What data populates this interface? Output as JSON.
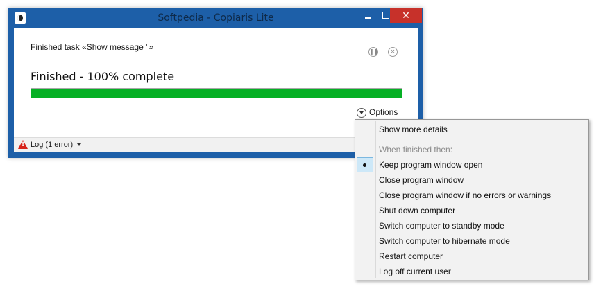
{
  "window": {
    "title": "Softpedia - Copiaris Lite",
    "close_label": "✕"
  },
  "task": {
    "label": "Finished task «Show message ''»",
    "status": "Finished - 100% complete",
    "progress_fraction": 1.0,
    "progress_color": "#06b025",
    "pause_icon": "pause-icon",
    "stop_icon": "stop-icon"
  },
  "options": {
    "label": "Options",
    "icon": "chevron-down-circle-icon"
  },
  "statusbar": {
    "log_label": "Log (1 error)",
    "log_icon": "warning-icon"
  },
  "menu": {
    "show_details": "Show more details",
    "header": "When finished then:",
    "items": [
      {
        "label": "Keep program window open",
        "checked": true
      },
      {
        "label": "Close program window",
        "checked": false
      },
      {
        "label": "Close program window if no errors or warnings",
        "checked": false
      },
      {
        "label": "Shut down computer",
        "checked": false
      },
      {
        "label": "Switch computer to standby mode",
        "checked": false
      },
      {
        "label": "Switch computer to hibernate mode",
        "checked": false
      },
      {
        "label": "Restart computer",
        "checked": false
      },
      {
        "label": "Log off current user",
        "checked": false
      }
    ]
  },
  "colors": {
    "accent": "#1d5fa8",
    "close": "#c7312a",
    "error": "#d7241b"
  }
}
